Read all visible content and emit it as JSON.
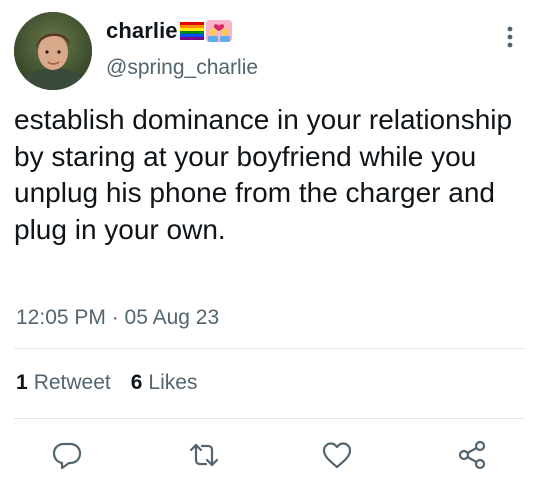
{
  "author": {
    "display_name": "charlie",
    "name_emojis": [
      "rainbow-flag-emoji",
      "two-men-heart-emoji"
    ],
    "handle": "@spring_charlie",
    "avatar": "profile-photo"
  },
  "tweet": {
    "text": "establish dominance in your relationship by staring at your boyfriend while you unplug his phone from the charger and plug in your own.",
    "timestamp": "12:05 PM · 05 Aug 23"
  },
  "stats": {
    "retweets_count": "1",
    "retweets_label": "Retweet",
    "likes_count": "6",
    "likes_label": "Likes"
  },
  "actions": [
    "reply-icon",
    "retweet-icon",
    "like-icon",
    "share-icon"
  ],
  "colors": {
    "text_primary": "#0f1419",
    "text_secondary": "#536471",
    "divider": "#e4e8eb",
    "icon": "#536471"
  }
}
